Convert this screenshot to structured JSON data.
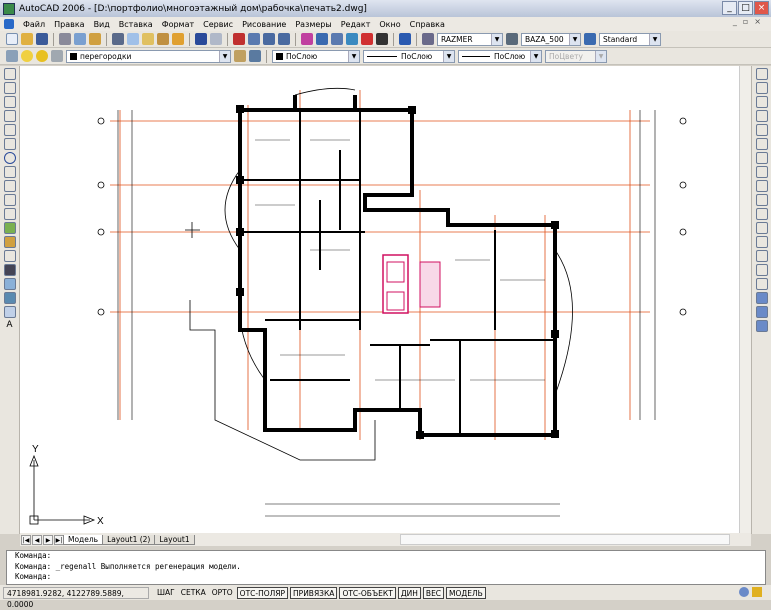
{
  "title": "AutoCAD 2006 - [D:\\портфолио\\многоэтажный дом\\рабочка\\печать2.dwg]",
  "menu": [
    "Файл",
    "Правка",
    "Вид",
    "Вставка",
    "Формат",
    "Сервис",
    "Рисование",
    "Размеры",
    "Редакт",
    "Окно",
    "Справка"
  ],
  "toolbar": {
    "text_style": "RAZMER",
    "dim_style": "BAZA_500",
    "table_style": "Standard"
  },
  "layers": {
    "current_layer": "перегородки",
    "color": "ПоСлою",
    "linetype": "ПоСлою",
    "lineweight": "ПоСлою",
    "plotstyle": "ПоЦвету"
  },
  "tabs": [
    {
      "label": "Модель",
      "active": true
    },
    {
      "label": "Layout1 (2)",
      "active": false
    },
    {
      "label": "Layout1",
      "active": false
    }
  ],
  "command_lines": [
    "Команда:",
    "Команда: _regenall Выполняется регенерация модели.",
    "Команда:"
  ],
  "status": {
    "coordinates": "4718981.9282, 4122789.5889, 0.0000",
    "buttons": [
      {
        "label": "ШАГ",
        "on": false
      },
      {
        "label": "СЕТКА",
        "on": false
      },
      {
        "label": "ОРТО",
        "on": false
      },
      {
        "label": "ОТС-ПОЛЯР",
        "on": true
      },
      {
        "label": "ПРИВЯЗКА",
        "on": true
      },
      {
        "label": "ОТС-ОБЪЕКТ",
        "on": true
      },
      {
        "label": "ДИН",
        "on": true
      },
      {
        "label": "ВЕС",
        "on": true
      },
      {
        "label": "МОДЕЛЬ",
        "on": true
      }
    ]
  },
  "ucs": {
    "x_label": "X",
    "y_label": "Y"
  },
  "colors": {
    "wall": "#000000",
    "axis": "#e0501a",
    "stair": "#d01060"
  }
}
